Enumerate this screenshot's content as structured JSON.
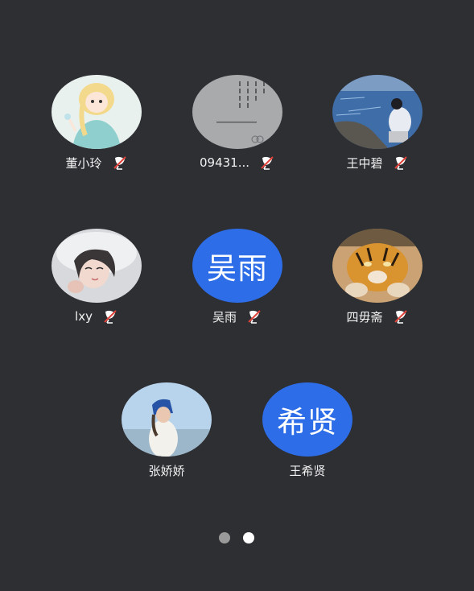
{
  "participants": [
    {
      "name": "董小玲",
      "avatar_type": "image",
      "avatar_icon": "anime-princess-avatar",
      "mic": "muted"
    },
    {
      "name": "09431...",
      "avatar_type": "image",
      "avatar_icon": "poem-avatar",
      "mic": "muted"
    },
    {
      "name": "王中碧",
      "avatar_type": "image",
      "avatar_icon": "lakeside-photo-avatar",
      "mic": "muted"
    },
    {
      "name": "lxy",
      "avatar_type": "image",
      "avatar_icon": "girl-photo-avatar",
      "mic": "muted"
    },
    {
      "name": "吴雨",
      "avatar_type": "text",
      "avatar_text": "吴雨",
      "mic": "muted"
    },
    {
      "name": "四毋斋",
      "avatar_type": "image",
      "avatar_icon": "tiger-avatar",
      "mic": "muted"
    },
    {
      "name": "张娇娇",
      "avatar_type": "image",
      "avatar_icon": "beach-photo-avatar",
      "mic": null
    },
    {
      "name": "王希贤",
      "avatar_type": "text",
      "avatar_text": "希贤",
      "mic": null
    }
  ],
  "pagination": {
    "pages": 2,
    "current": 2
  },
  "colors": {
    "background": "#2e2f33",
    "text_avatar": "#2d6de8",
    "mute_slash": "#e0433a"
  }
}
